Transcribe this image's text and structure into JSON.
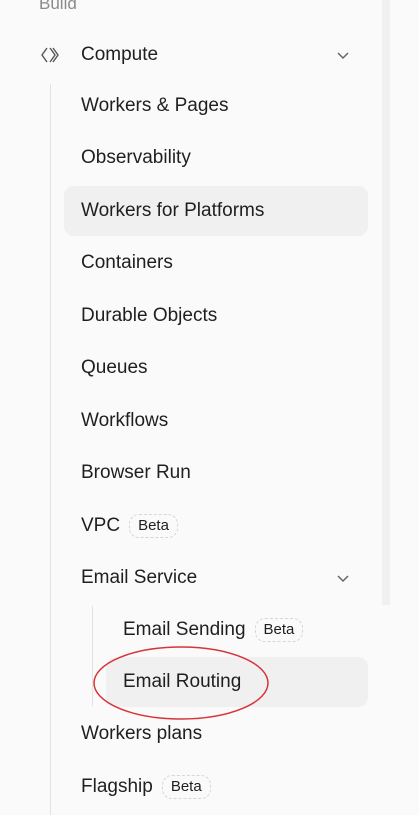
{
  "section": {
    "label": "Build"
  },
  "compute": {
    "label": "Compute"
  },
  "items": [
    {
      "label": "Workers & Pages"
    },
    {
      "label": "Observability"
    },
    {
      "label": "Workers for Platforms"
    },
    {
      "label": "Containers"
    },
    {
      "label": "Durable Objects"
    },
    {
      "label": "Queues"
    },
    {
      "label": "Workflows"
    },
    {
      "label": "Browser Run"
    },
    {
      "label": "VPC",
      "badge": "Beta"
    },
    {
      "label": "Email Service"
    },
    {
      "label": "Workers plans"
    },
    {
      "label": "Flagship",
      "badge": "Beta"
    }
  ],
  "email_sub": [
    {
      "label": "Email Sending",
      "badge": "Beta"
    },
    {
      "label": "Email Routing"
    }
  ],
  "colors": {
    "annotation": "#d9333a",
    "active_bg": "#f0f0f0"
  }
}
